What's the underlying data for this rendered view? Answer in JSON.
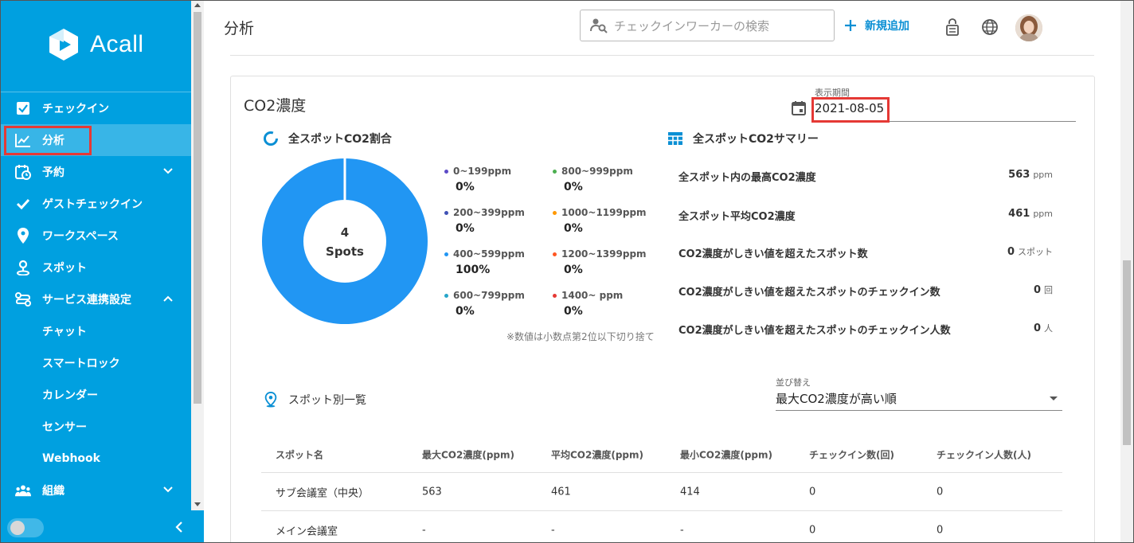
{
  "app": {
    "logo_text": "Acall"
  },
  "sidebar": {
    "items": [
      {
        "label": "チェックイン"
      },
      {
        "label": "分析"
      },
      {
        "label": "予約"
      },
      {
        "label": "ゲストチェックイン"
      },
      {
        "label": "ワークスペース"
      },
      {
        "label": "スポット"
      },
      {
        "label": "サービス連携設定"
      },
      {
        "label": "チャット"
      },
      {
        "label": "スマートロック"
      },
      {
        "label": "カレンダー"
      },
      {
        "label": "センサー"
      },
      {
        "label": "Webhook"
      },
      {
        "label": "組織"
      }
    ]
  },
  "header": {
    "title": "分析",
    "search_placeholder": "チェックインワーカーの検索",
    "add_label": "新規追加"
  },
  "card": {
    "title": "CO2濃度",
    "period_label": "表示期間",
    "period_value": "2021-08-05",
    "ratio_title": "全スポットCO2割合",
    "summary_title": "全スポットCO2サマリー",
    "donut_count": "4",
    "donut_unit": "Spots",
    "note": "※数値は小数点第2位以下切り捨て"
  },
  "chart_data": {
    "type": "pie",
    "categories": [
      "0~199ppm",
      "800~999ppm",
      "200~399ppm",
      "1000~1199ppm",
      "400~599ppm",
      "1200~1399ppm",
      "600~799ppm",
      "1400~ ppm"
    ],
    "values": [
      0,
      0,
      0,
      0,
      100,
      0,
      0,
      0
    ],
    "labels": [
      "0%",
      "0%",
      "0%",
      "0%",
      "100%",
      "0%",
      "0%",
      "0%"
    ],
    "colors": [
      "#5c4bc7",
      "#4caf50",
      "#3f51b5",
      "#ff9800",
      "#2196f3",
      "#ff5722",
      "#26a5c9",
      "#e53935"
    ]
  },
  "summary": [
    {
      "label": "全スポット内の最高CO2濃度",
      "value": "563",
      "unit": "ppm"
    },
    {
      "label": "全スポット平均CO2濃度",
      "value": "461",
      "unit": "ppm"
    },
    {
      "label": "CO2濃度がしきい値を超えたスポット数",
      "value": "0",
      "unit": "スポット"
    },
    {
      "label": "CO2濃度がしきい値を超えたスポットのチェックイン数",
      "value": "0",
      "unit": "回"
    },
    {
      "label": "CO2濃度がしきい値を超えたスポットのチェックイン人数",
      "value": "0",
      "unit": "人"
    }
  ],
  "spots": {
    "title": "スポット別一覧",
    "sort_label": "並び替え",
    "sort_value": "最大CO2濃度が高い順",
    "columns": [
      "スポット名",
      "最大CO2濃度(ppm)",
      "平均CO2濃度(ppm)",
      "最小CO2濃度(ppm)",
      "チェックイン数(回)",
      "チェックイン人数(人)"
    ],
    "rows": [
      [
        "サブ会議室（中央）",
        "563",
        "461",
        "414",
        "0",
        "0"
      ],
      [
        "メイン会議室",
        "-",
        "-",
        "-",
        "0",
        "0"
      ]
    ]
  }
}
